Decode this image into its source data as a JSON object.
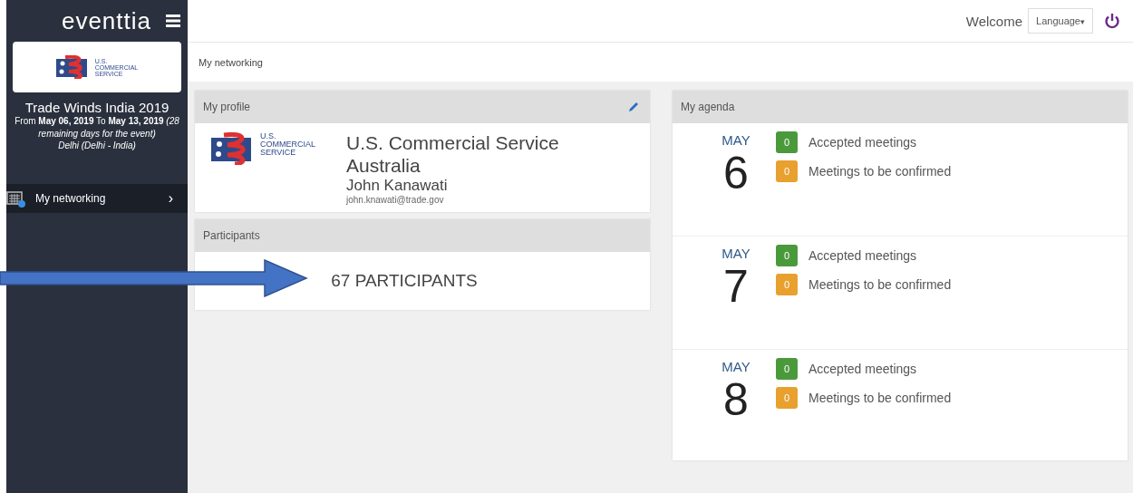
{
  "sidebar": {
    "brand": "eventtia",
    "logo_lines": [
      "U.S.",
      "COMMERCIAL",
      "SERVICE"
    ],
    "event_title": "Trade Winds India 2019",
    "event_dates": "From **May 06, 2019** To **May 13, 2019** *(28 remaining days for the event)*",
    "event_location": "Delhi (Delhi - India)",
    "items": [
      {
        "label": "My networking",
        "selected": true,
        "badge": true,
        "chevron": "›"
      }
    ]
  },
  "topbar": {
    "welcome": "Welcome",
    "language": "Language",
    "caret": "▾"
  },
  "breadcrumb": "My networking",
  "profile": {
    "title": "My profile",
    "logo_lines": [
      "U.S.",
      "COMMERCIAL",
      "SERVICE"
    ],
    "company": "U.S. Commercial Service Australia",
    "name": "John Kanawati",
    "email": "john.knawati@trade.gov"
  },
  "participants": {
    "title": "Participants",
    "count": "67 PARTICIPANTS"
  },
  "agenda": {
    "title": "My agenda",
    "days": [
      {
        "month": "MAY",
        "day": "6",
        "stats": [
          {
            "count": "0",
            "label": "Accepted meetings",
            "color": "#4a9a3c"
          },
          {
            "count": "0",
            "label": "Meetings to be confirmed",
            "color": "#e8a02e"
          }
        ]
      },
      {
        "month": "MAY",
        "day": "7",
        "stats": [
          {
            "count": "0",
            "label": "Accepted meetings",
            "color": "#4a9a3c"
          },
          {
            "count": "0",
            "label": "Meetings to be confirmed",
            "color": "#e8a02e"
          }
        ]
      },
      {
        "month": "MAY",
        "day": "8",
        "stats": [
          {
            "count": "0",
            "label": "Accepted meetings",
            "color": "#4a9a3c"
          },
          {
            "count": "0",
            "label": "Meetings to be confirmed",
            "color": "#e8a02e"
          }
        ]
      }
    ]
  }
}
